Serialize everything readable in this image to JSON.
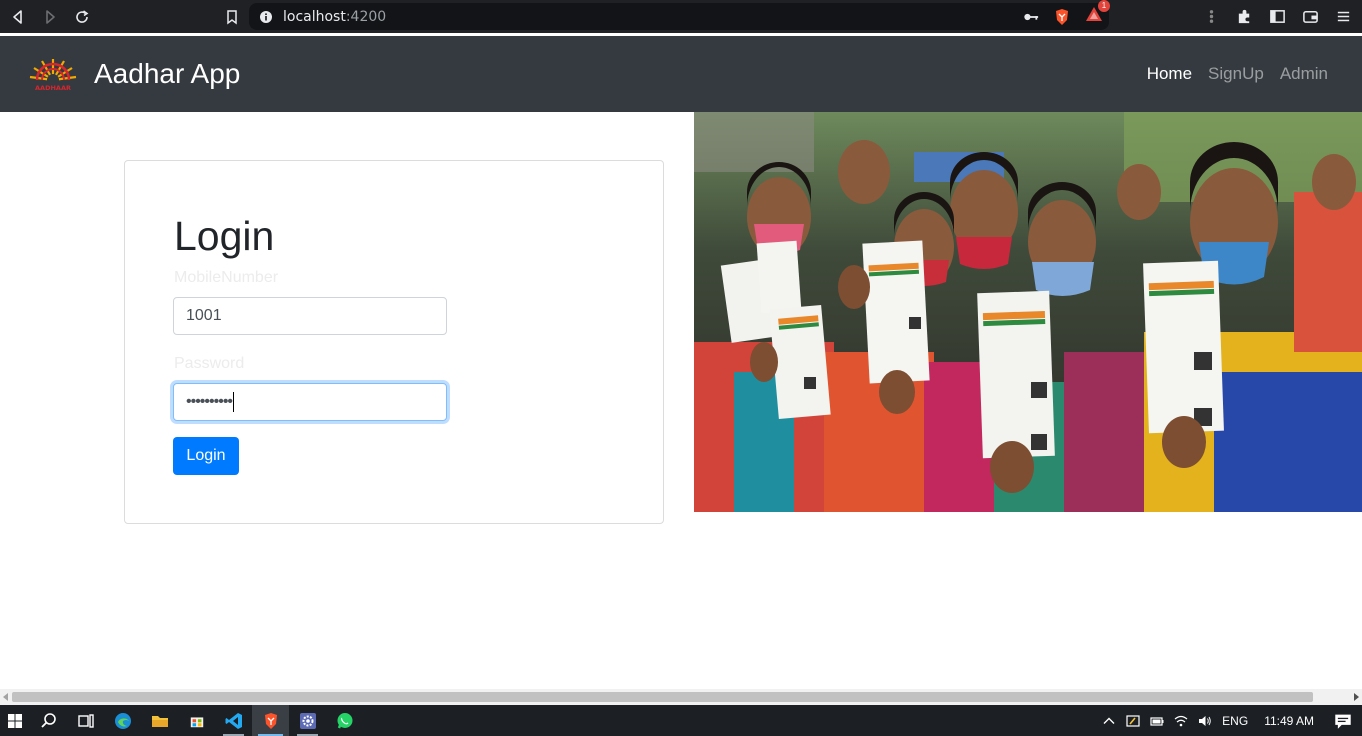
{
  "browser": {
    "url_host": "localhost",
    "url_port": ":4200",
    "brave_badge": "1"
  },
  "navbar": {
    "title": "Aadhar App",
    "logo_text": "AADHAAR",
    "links": [
      {
        "label": "Home",
        "active": true
      },
      {
        "label": "SignUp",
        "active": false
      },
      {
        "label": "Admin",
        "active": false
      }
    ]
  },
  "login": {
    "title": "Login",
    "mobile_label": "MobileNumber",
    "mobile_value": "1001",
    "password_label": "Password",
    "password_value": "••••••••••",
    "button_label": "Login"
  },
  "taskbar": {
    "language": "ENG",
    "time": "11:49 AM"
  },
  "colors": {
    "navbar_bg": "#343a40",
    "primary": "#007bff"
  }
}
